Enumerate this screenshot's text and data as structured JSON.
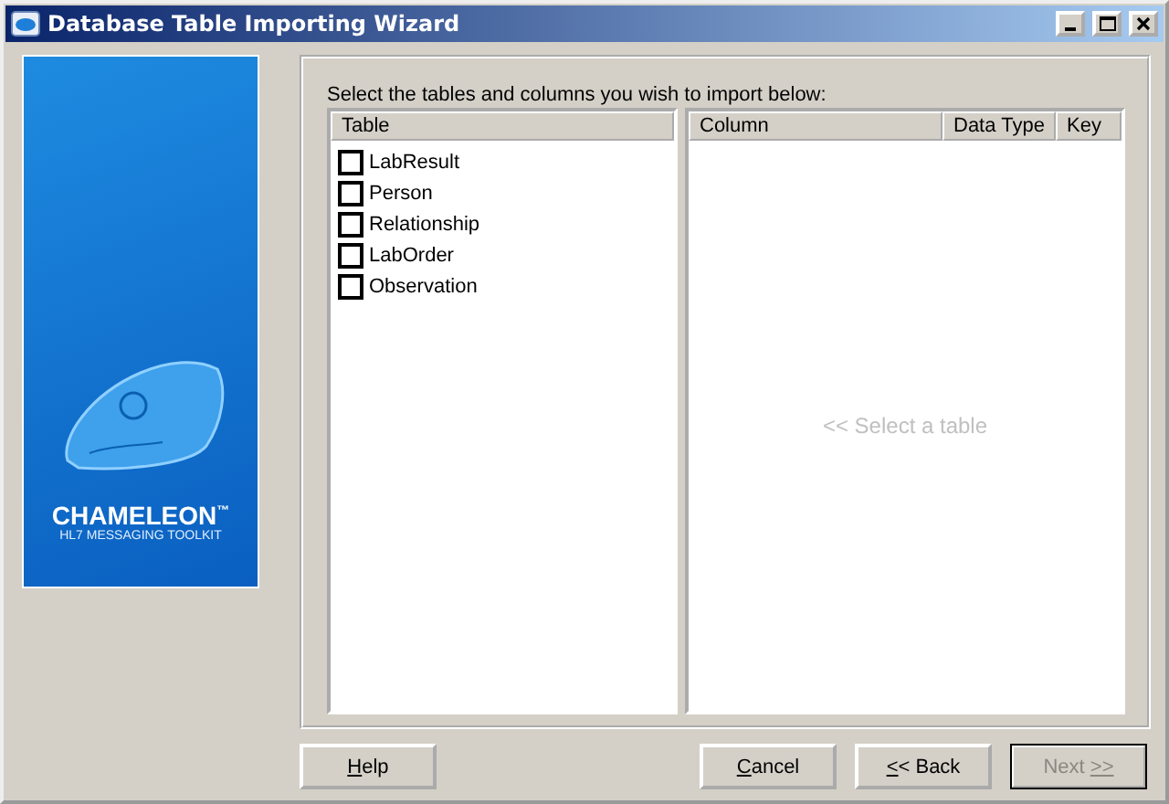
{
  "window": {
    "title": "Database Table Importing Wizard"
  },
  "logo": {
    "name": "CHAMELEON$^{™}$",
    "tagline": "HL7 MESSAGING TOOLKIT"
  },
  "instruction": "Select the tables and columns you wish to import below:",
  "tables": {
    "header": "Table",
    "items": [
      {
        "label": "LabResult",
        "checked": false
      },
      {
        "label": "Person",
        "checked": false
      },
      {
        "label": "Relationship",
        "checked": false
      },
      {
        "label": "LabOrder",
        "checked": false
      },
      {
        "label": "Observation",
        "checked": false
      }
    ]
  },
  "columns": {
    "headers": [
      "Column",
      "Data Type",
      "Key"
    ],
    "empty_text": "<< Select a table"
  },
  "buttons": [
    {
      "key": "H",
      "after": "elp",
      "disabled": false,
      "default": false
    },
    {
      "key": "C",
      "after": "ancel",
      "disabled": false,
      "default": false
    },
    {
      "key": "<",
      "after": "< Back",
      "disabled": false,
      "default": false
    },
    {
      "before": "Next ",
      "key": ">>",
      "disabled": true,
      "default": true
    }
  ]
}
